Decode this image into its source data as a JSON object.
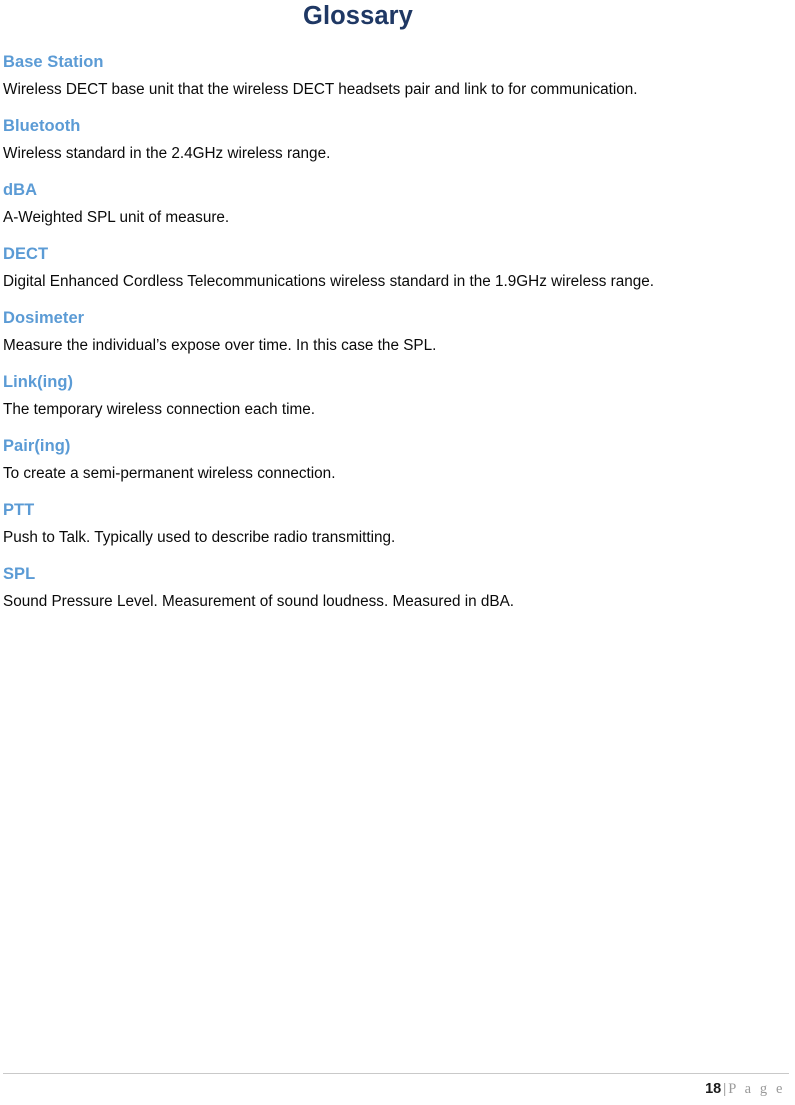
{
  "document": {
    "title": "Glossary"
  },
  "glossary": {
    "entries": [
      {
        "term": "Base Station",
        "definition": "Wireless DECT base unit that the wireless DECT headsets pair and link to for communication.",
        "justified": true
      },
      {
        "term": "Bluetooth",
        "definition": "Wireless standard in the 2.4GHz wireless range.",
        "justified": false
      },
      {
        "term": "dBA",
        "definition": "A-Weighted SPL unit of measure.",
        "justified": false
      },
      {
        "term": "DECT",
        "definition": "Digital Enhanced Cordless Telecommunications wireless standard in the 1.9GHz wireless range.",
        "justified": true
      },
      {
        "term": "Dosimeter",
        "definition": "Measure the individual’s expose over time. In this case the SPL.",
        "justified": false
      },
      {
        "term": "Link(ing)",
        "definition": "The temporary wireless connection each time.",
        "justified": false
      },
      {
        "term": "Pair(ing)",
        "definition": "To create a semi-permanent wireless connection.",
        "justified": false
      },
      {
        "term": "PTT",
        "definition": "Push to Talk. Typically used to describe radio transmitting.",
        "justified": false
      },
      {
        "term": "SPL",
        "definition": "Sound Pressure Level. Measurement of sound loudness. Measured in dBA.",
        "justified": false
      }
    ]
  },
  "footer": {
    "page_number": "18",
    "separator": "|",
    "label": "P a g e"
  },
  "colors": {
    "title": "#1F3864",
    "term": "#5B9BD5",
    "body": "#0A0A0A",
    "footer_rule": "#C9C9C9",
    "footer_label": "#9A9A9A"
  }
}
